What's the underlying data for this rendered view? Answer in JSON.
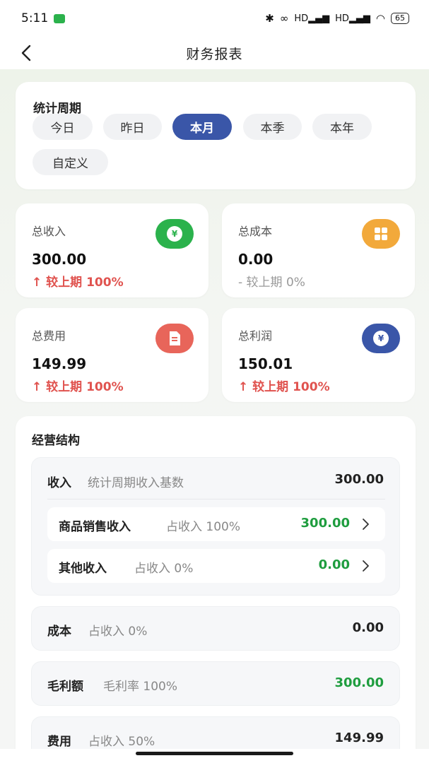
{
  "status_bar": {
    "time": "5:11",
    "battery": "65",
    "signal1": "HD",
    "signal2": "HD"
  },
  "header": {
    "title": "财务报表"
  },
  "period": {
    "title": "统计周期",
    "options": [
      "今日",
      "昨日",
      "本月",
      "本季",
      "本年",
      "自定义"
    ],
    "selected": "本月"
  },
  "stats": [
    {
      "label": "总收入",
      "value": "300.00",
      "change": "↑ 较上期 100%",
      "icon": "yuan-icon",
      "color": "#2bb24c"
    },
    {
      "label": "总成本",
      "value": "0.00",
      "change": "- 较上期 0%",
      "icon": "grid-icon",
      "color": "#f2a93b"
    },
    {
      "label": "总费用",
      "value": "149.99",
      "change": "↑ 较上期 100%",
      "icon": "document-icon",
      "color": "#e8655a"
    },
    {
      "label": "总利润",
      "value": "150.01",
      "change": "↑ 较上期 100%",
      "icon": "yuan-icon",
      "color": "#3a56a8"
    }
  ],
  "structure": {
    "title": "经营结构",
    "income": {
      "title": "收入",
      "subtitle": "统计周期收入基数",
      "value": "300.00"
    },
    "income_items": [
      {
        "title": "商品销售收入",
        "subtitle": "占收入 100%",
        "value": "300.00"
      },
      {
        "title": "其他收入",
        "subtitle": "占收入 0%",
        "value": "0.00"
      }
    ],
    "cost": {
      "title": "成本",
      "subtitle": "占收入 0%",
      "value": "0.00"
    },
    "gross": {
      "title": "毛利额",
      "subtitle": "毛利率 100%",
      "value": "300.00"
    },
    "expense": {
      "title": "费用",
      "subtitle": "占收入 50%",
      "value": "149.99"
    }
  },
  "colors": {
    "accent": "#3a56a8",
    "positive_green": "#1f9d3f",
    "change_red": "#e0534f"
  }
}
